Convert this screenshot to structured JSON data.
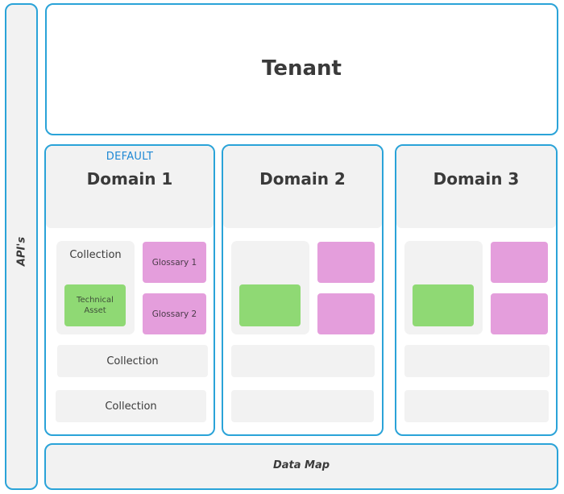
{
  "colors": {
    "border": "#2aa3d8",
    "panel_fill": "#f2f2f2",
    "default_badge": "#1e88d4",
    "technical_asset": "#8fd974",
    "glossary": "#e49edc"
  },
  "apis": {
    "label": "API's"
  },
  "tenant": {
    "title": "Tenant"
  },
  "domains": [
    {
      "badge": "DEFAULT",
      "title": "Domain 1",
      "collection_main": {
        "label": "Collection",
        "asset": "Technical Asset"
      },
      "glossaries": [
        "Glossary 1",
        "Glossary 2"
      ],
      "collections": [
        "Collection",
        "Collection"
      ]
    },
    {
      "badge": "",
      "title": "Domain 2",
      "collection_main": {
        "label": "",
        "asset": ""
      },
      "glossaries": [
        "",
        ""
      ],
      "collections": [
        "",
        ""
      ]
    },
    {
      "badge": "",
      "title": "Domain 3",
      "collection_main": {
        "label": "",
        "asset": ""
      },
      "glossaries": [
        "",
        ""
      ],
      "collections": [
        "",
        ""
      ]
    }
  ],
  "datamap": {
    "title": "Data Map"
  }
}
